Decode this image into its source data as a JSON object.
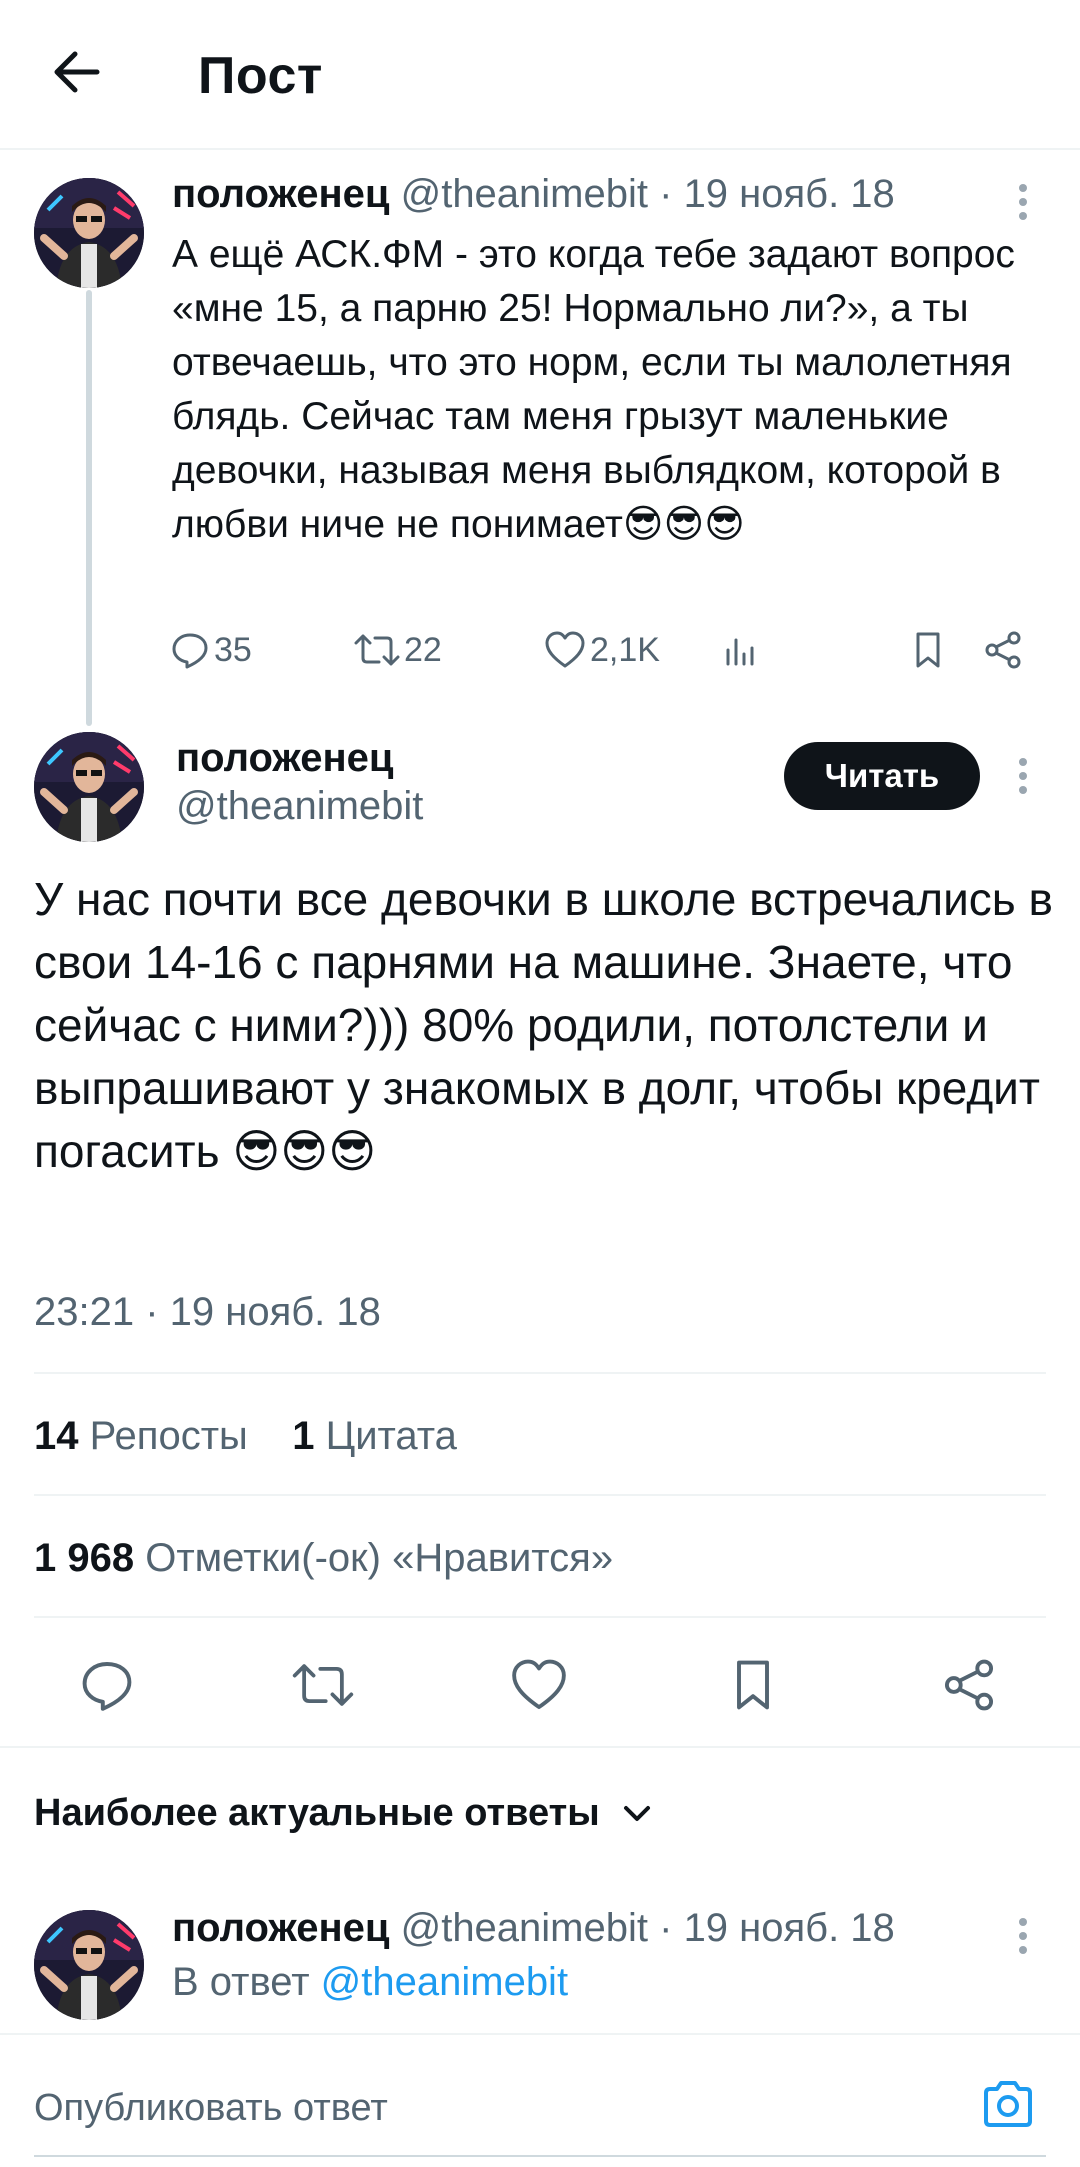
{
  "header": {
    "title": "Пост"
  },
  "colors": {
    "accent": "#1d9bf0",
    "text": "#0f1419",
    "muted": "#536471",
    "follow_bg": "#0f1419"
  },
  "parent_tweet": {
    "name": "положенец",
    "handle": "@theanimebit",
    "date": "19 нояб. 18",
    "text": "А ещё АСК.ФМ - это когда тебе задают вопрос «мне 15, а парню 25! Нормально ли?», а ты отвечаешь, что это норм, если ты малолетняя блядь. Сейчас там меня грызут маленькие девочки, называя меня выблядком, которой в любви ниче не понимает😎😎😎",
    "replies": "35",
    "retweets": "22",
    "likes": "2,1K"
  },
  "main_tweet": {
    "name": "положенец",
    "handle": "@theanimebit",
    "follow_label": "Читать",
    "text": "У нас почти все девочки в школе встречались в свои 14-16 с парнями на машине. Знаете, что сейчас с ними?))) 80% родили, потолстели и выпрашивают у знакомых в долг, чтобы кредит погасить 😎😎😎",
    "timestamp": "23:21 · 19 нояб. 18",
    "reposts_count": "14",
    "reposts_label": "Репосты",
    "quotes_count": "1",
    "quotes_label": "Цитата",
    "likes_count": "1 968",
    "likes_label": "Отметки(-ок) «Нравится»"
  },
  "replies_section": {
    "sort_label": "Наиболее актуальные ответы"
  },
  "reply_tweet": {
    "name": "положенец",
    "handle": "@theanimebit",
    "date": "19 нояб. 18",
    "reply_prefix": "В ответ",
    "reply_to": "@theanimebit"
  },
  "compose": {
    "placeholder": "Опубликовать ответ"
  },
  "icons": {
    "back": "arrow-left-icon",
    "more": "more-vertical-icon",
    "reply": "reply-icon",
    "retweet": "retweet-icon",
    "like": "heart-icon",
    "views": "bar-chart-icon",
    "bookmark": "bookmark-icon",
    "share": "share-icon",
    "chevron": "chevron-down-icon",
    "camera": "camera-icon"
  }
}
